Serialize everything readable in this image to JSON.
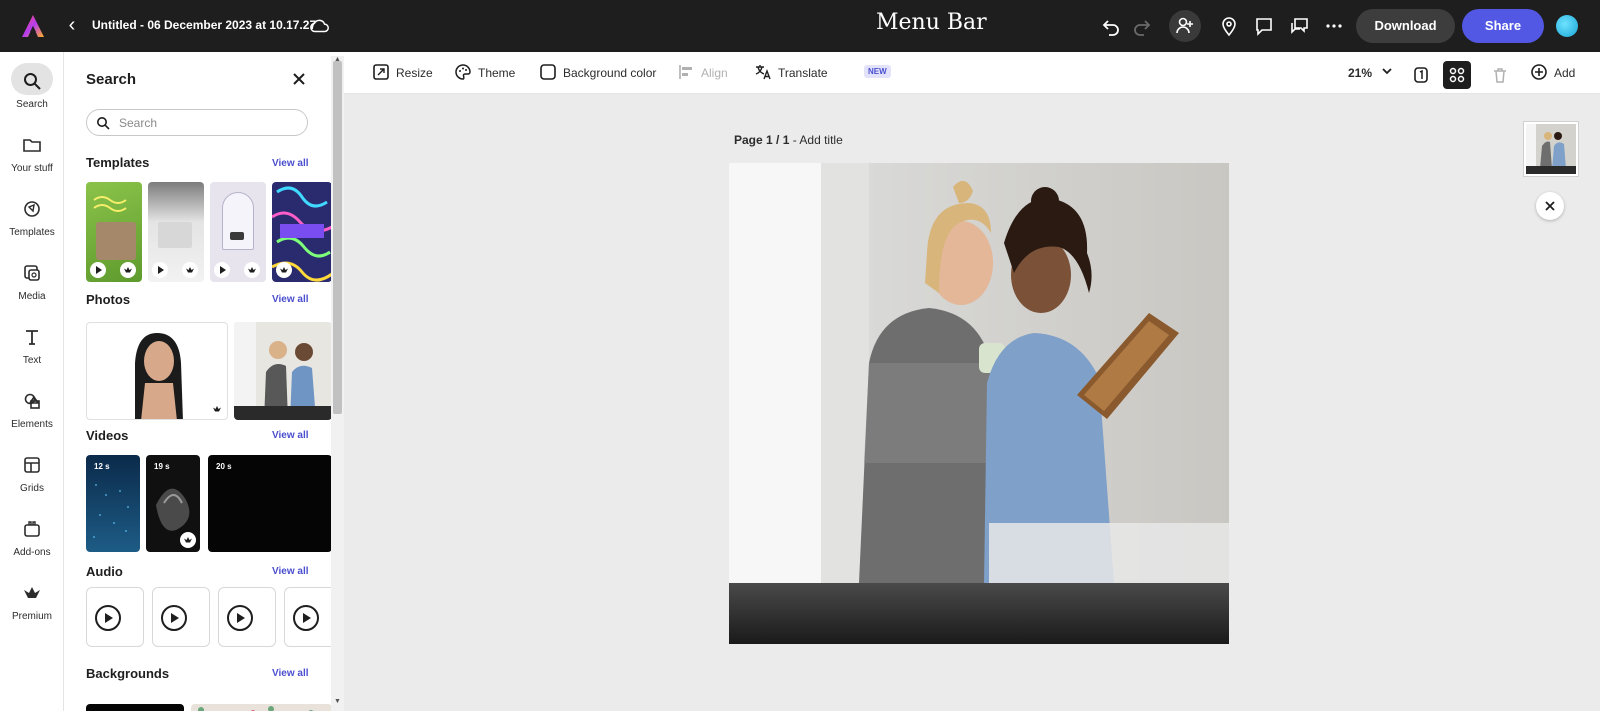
{
  "topbar": {
    "doc_title": "Untitled - 06 December 2023 at 10.17.27",
    "menubar_label": "Menu Bar",
    "download_label": "Download",
    "share_label": "Share"
  },
  "rail": {
    "items": [
      {
        "label": "Search",
        "icon": "search-icon"
      },
      {
        "label": "Your stuff",
        "icon": "folder-icon"
      },
      {
        "label": "Templates",
        "icon": "templates-icon"
      },
      {
        "label": "Media",
        "icon": "media-icon"
      },
      {
        "label": "Text",
        "icon": "text-icon"
      },
      {
        "label": "Elements",
        "icon": "elements-icon"
      },
      {
        "label": "Grids",
        "icon": "grids-icon"
      },
      {
        "label": "Add-ons",
        "icon": "addons-icon"
      },
      {
        "label": "Premium",
        "icon": "crown-icon"
      }
    ]
  },
  "panel": {
    "title": "Search",
    "search_placeholder": "Search",
    "sections": {
      "templates": {
        "title": "Templates",
        "view_all": "View all"
      },
      "photos": {
        "title": "Photos",
        "view_all": "View all"
      },
      "videos": {
        "title": "Videos",
        "view_all": "View all",
        "durations": [
          "12 s",
          "19 s",
          "20 s"
        ]
      },
      "audio": {
        "title": "Audio",
        "view_all": "View all"
      },
      "backgrounds": {
        "title": "Backgrounds",
        "view_all": "View all"
      }
    }
  },
  "toolbar": {
    "resize": "Resize",
    "theme": "Theme",
    "background_color": "Background color",
    "align": "Align",
    "translate": "Translate",
    "translate_badge": "NEW",
    "zoom": "21%",
    "add": "Add"
  },
  "canvas": {
    "page_indicator": "Page 1 / 1",
    "add_title": "Add title"
  },
  "colors": {
    "topbar_bg": "#1e1e1e",
    "share_accent": "#5258e4",
    "link_accent": "#4b4fcf"
  }
}
